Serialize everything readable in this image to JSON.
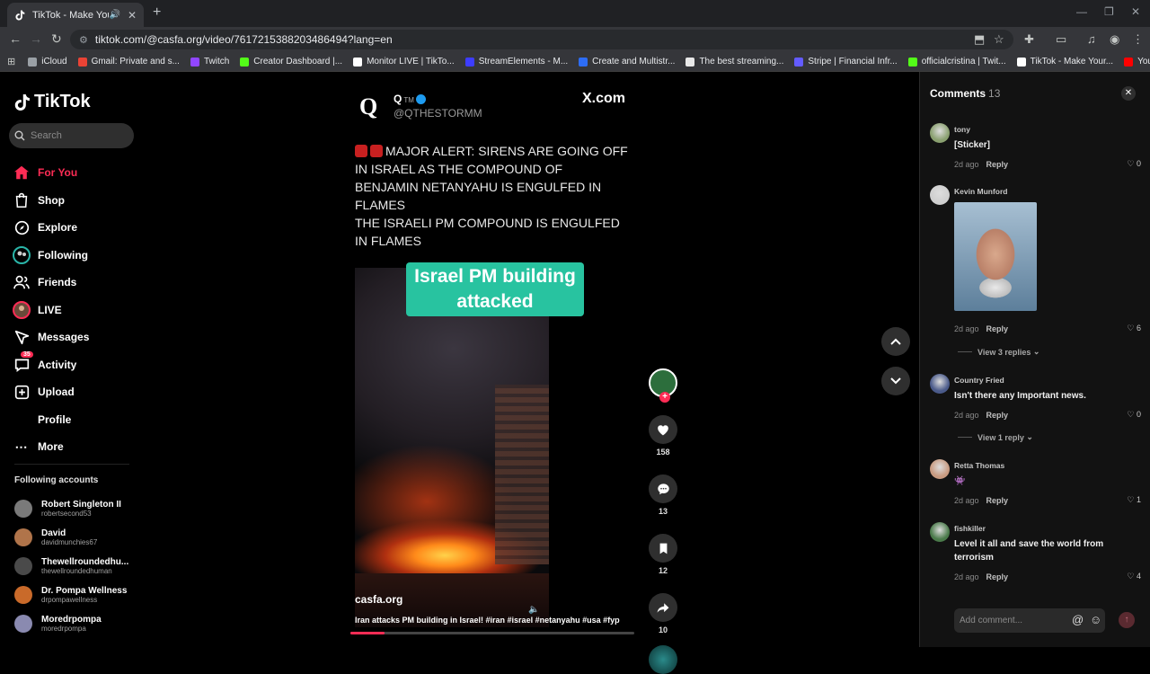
{
  "browser": {
    "tab_title": "TikTok - Make Your Day",
    "url": "tiktok.com/@casfa.org/video/7617215388203486494?lang=en",
    "bookmarks": [
      {
        "label": "iCloud",
        "color": "#9aa0a6"
      },
      {
        "label": "Gmail: Private and s...",
        "color": "#ea4335"
      },
      {
        "label": "Twitch",
        "color": "#9146ff"
      },
      {
        "label": "Creator Dashboard |...",
        "color": "#53fc18"
      },
      {
        "label": "Monitor LIVE | TikTo...",
        "color": "#ffffff"
      },
      {
        "label": "StreamElements - M...",
        "color": "#3d3dff"
      },
      {
        "label": "Create and Multistr...",
        "color": "#2d6df6"
      },
      {
        "label": "The best streaming...",
        "color": "#e8e8e8"
      },
      {
        "label": "Stripe | Financial Infr...",
        "color": "#635bff"
      },
      {
        "label": "officialcristina | Twit...",
        "color": "#53fc18"
      },
      {
        "label": "TikTok - Make Your...",
        "color": "#ffffff"
      },
      {
        "label": "YouTube",
        "color": "#ff0000"
      }
    ]
  },
  "tiktok": {
    "logo_text": "TikTok",
    "search_placeholder": "Search",
    "nav": [
      {
        "label": "For You",
        "icon": "home-icon"
      },
      {
        "label": "Shop",
        "icon": "shop-icon"
      },
      {
        "label": "Explore",
        "icon": "compass-icon"
      },
      {
        "label": "Following",
        "icon": "following-icon"
      },
      {
        "label": "Friends",
        "icon": "friends-icon"
      },
      {
        "label": "LIVE",
        "icon": "live-icon"
      },
      {
        "label": "Messages",
        "icon": "messages-icon"
      },
      {
        "label": "Activity",
        "icon": "activity-icon",
        "badge": "35"
      },
      {
        "label": "Upload",
        "icon": "upload-icon"
      },
      {
        "label": "Profile",
        "icon": "profile-icon"
      },
      {
        "label": "More",
        "icon": "more-icon"
      }
    ],
    "following_title": "Following accounts",
    "following_accounts": [
      {
        "name": "Robert Singleton II",
        "handle": "robertsecond53",
        "color": "#7a7a7a"
      },
      {
        "name": "David",
        "handle": "davidmunchies67",
        "color": "#b0744a"
      },
      {
        "name": "Thewellroundedhu...",
        "handle": "thewellroundedhuman",
        "color": "#4a4a4a"
      },
      {
        "name": "Dr. Pompa Wellness",
        "handle": "drpompawellness",
        "color": "#c96a2a"
      },
      {
        "name": "Moredrpompa",
        "handle": "moredrpompa",
        "color": "#8a8ab0"
      }
    ]
  },
  "video": {
    "tweet_logo": "Q",
    "tweet_name": "Q",
    "tweet_tm": "TM",
    "tweet_handle": "@QTHESTORMM",
    "xcom": "X.com",
    "alert_text": "MAJOR ALERT: SIRENS ARE GOING OFF IN ISRAEL AS THE COMPOUND OF BENJAMIN NETANYAHU IS ENGULFED IN FLAMES",
    "pm_text": "THE ISRAELI PM COMPOUND IS ENGULFED IN FLAMES",
    "caption_overlay": "Israel PM building attacked",
    "author": "casfa.org",
    "description": "Iran attacks PM building in Israel! #iran #israel #netanyahu #usa #fyp",
    "progress": 0.12,
    "likes": "158",
    "comments": "13",
    "saves": "12",
    "shares": "10"
  },
  "comments_panel": {
    "title": "Comments",
    "count": "13",
    "comments": [
      {
        "user": "tony",
        "text": "[Sticker]",
        "time": "2d ago",
        "reply": "Reply",
        "likes": "0",
        "avatar_color": "#8aa070"
      },
      {
        "user": "Kevin Munford",
        "text": "",
        "time": "2d ago",
        "reply": "Reply",
        "likes": "6",
        "avatar_color": "#cfcfcf",
        "view_replies": "View 3 replies"
      },
      {
        "user": "Country Fried",
        "text": "Isn't there any Important news.",
        "time": "2d ago",
        "reply": "Reply",
        "likes": "0",
        "avatar_color": "#4a5a8a",
        "view_replies": "View 1 reply"
      },
      {
        "user": "Retta Thomas",
        "text": "👾",
        "time": "2d ago",
        "reply": "Reply",
        "likes": "1",
        "avatar_color": "#c89a80"
      },
      {
        "user": "fishkiller",
        "text": "Level it all and save the world from terrorism",
        "time": "2d ago",
        "reply": "Reply",
        "likes": "4",
        "avatar_color": "#4a7a4a"
      }
    ],
    "add_comment_placeholder": "Add comment..."
  }
}
